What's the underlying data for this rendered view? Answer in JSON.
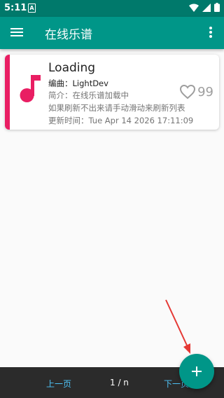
{
  "status_bar": {
    "time": "5:11",
    "notification_letter": "A",
    "icons": [
      "wifi-icon",
      "signal-icon",
      "battery-icon"
    ]
  },
  "app_bar": {
    "title": "在线乐谱",
    "menu_icon": "hamburger-menu-icon",
    "overflow_icon": "more-vert-icon"
  },
  "score_list": [
    {
      "title": "Loading",
      "author_line": "编曲：LightDev",
      "intro_line": "简介：在线乐谱加载中",
      "hint_line": "如果刷新不出来请手动滑动来刷新列表",
      "updated_line": "更新时间：Tue Apr 14 2026 17:11:09",
      "favorite_count": "99",
      "icon": "music-note-icon",
      "accent_color": "#e91e63"
    }
  ],
  "pagination": {
    "prev_label": "上一页",
    "page_indicator": "1 / n",
    "next_label": "下一页"
  },
  "fab": {
    "icon": "plus-icon"
  },
  "colors": {
    "primary": "#009688",
    "primary_dark": "#00796b",
    "accent": "#e91e63",
    "link": "#4fc3f7",
    "annotation_arrow": "#e53935"
  }
}
